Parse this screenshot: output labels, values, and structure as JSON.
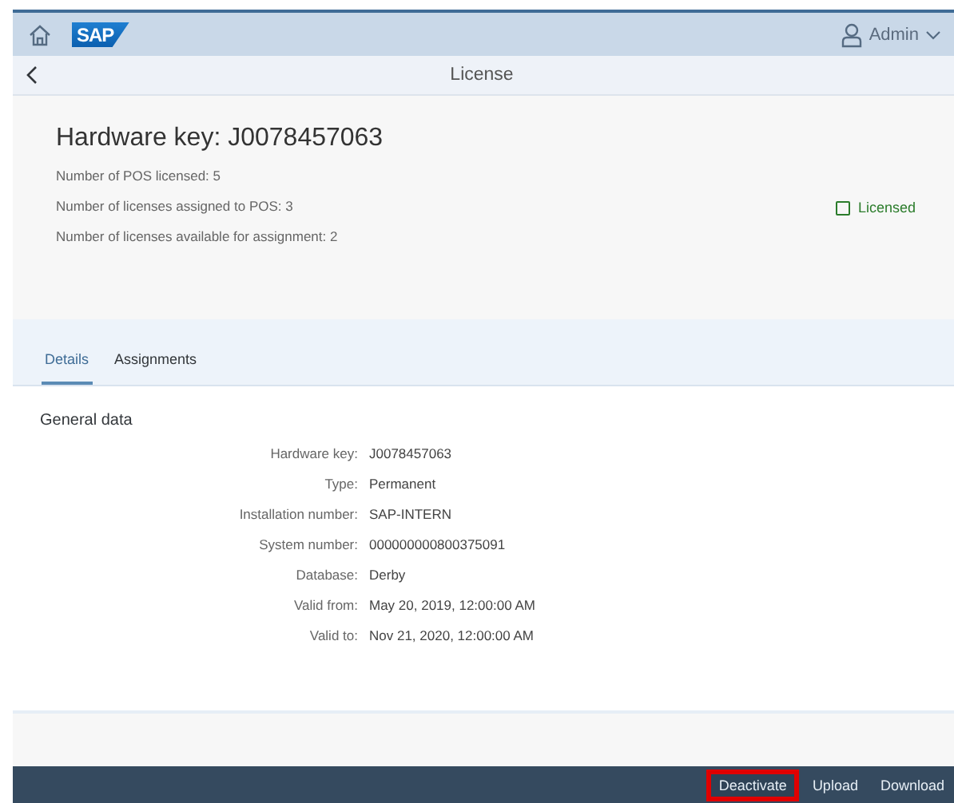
{
  "shell": {
    "logo": "SAP",
    "user": "Admin"
  },
  "nav": {
    "title": "License"
  },
  "header": {
    "title": "Hardware key: J0078457063",
    "status": "Licensed",
    "attributes": [
      "Number of POS licensed: 5",
      "Number of licenses assigned to POS: 3",
      "Number of licenses available for assignment: 2"
    ]
  },
  "tabs": [
    {
      "label": "Details",
      "selected": true
    },
    {
      "label": "Assignments",
      "selected": false
    }
  ],
  "section": {
    "title": "General data",
    "fields": [
      {
        "label": "Hardware key:",
        "value": "J0078457063"
      },
      {
        "label": "Type:",
        "value": "Permanent"
      },
      {
        "label": "Installation number:",
        "value": "SAP-INTERN"
      },
      {
        "label": "System number:",
        "value": "000000000800375091"
      },
      {
        "label": "Database:",
        "value": "Derby"
      },
      {
        "label": "Valid from:",
        "value": "May 20, 2019, 12:00:00 AM"
      },
      {
        "label": "Valid to:",
        "value": "Nov 21, 2020, 12:00:00 AM"
      }
    ]
  },
  "footer": {
    "buttons": [
      {
        "label": "Deactivate",
        "highlighted": true
      },
      {
        "label": "Upload",
        "highlighted": false
      },
      {
        "label": "Download",
        "highlighted": false
      }
    ]
  }
}
